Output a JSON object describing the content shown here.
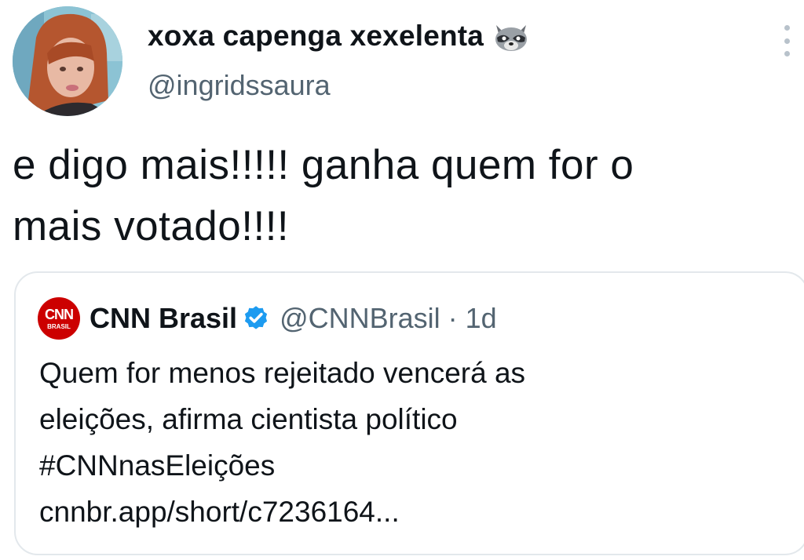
{
  "tweet": {
    "display_name": "xoxa capenga xexelenta",
    "handle": "@ingridssaura",
    "text_line1": "e digo mais!!!!! ganha quem for o",
    "text_line2": "mais votado!!!!"
  },
  "quote": {
    "display_name": "CNN Brasil",
    "handle": "@CNNBrasil",
    "separator": "·",
    "time": "1d",
    "logo_text": "CNN",
    "logo_subtext": "BRASIL",
    "body_line1": "Quem for menos rejeitado vencerá as",
    "body_line2": "eleições, afirma cientista político",
    "body_line3": "#CNNnasEleições",
    "body_line4": "cnnbr.app/short/c7236164..."
  },
  "icons": {
    "emoji": "raccoon-icon",
    "more": "more-options-icon",
    "verified": "verified-badge-icon"
  },
  "colors": {
    "text": "#0f1419",
    "secondary": "#536471",
    "verified": "#1d9bf0",
    "cnn_red": "#cc0000",
    "border": "#e3e8ec"
  }
}
